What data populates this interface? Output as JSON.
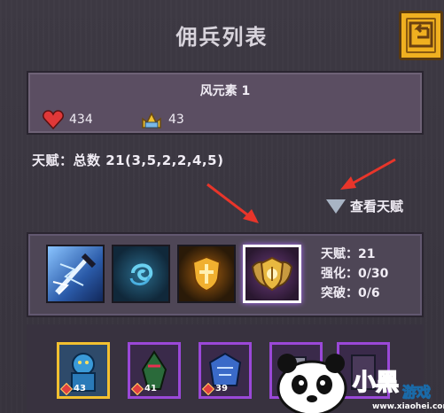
{
  "header": {
    "title": "佣兵列表"
  },
  "unit": {
    "name": "风元素 1",
    "hp": "434",
    "attack": "43"
  },
  "talents": {
    "total_line": "天赋：总数 21(3,5,2,2,4,5)",
    "view_label": "查看天赋"
  },
  "selected_skill": {
    "talent_line": "天赋：21",
    "enhance_line": "强化：0/30",
    "breakthrough_line": "突破：0/6"
  },
  "skills": [
    {
      "icon": "lightning-sword-icon",
      "color": "#3a6ab8"
    },
    {
      "icon": "wind-swirl-icon",
      "color": "#1e4a6a"
    },
    {
      "icon": "golden-shield-icon",
      "color": "#7a4a10"
    },
    {
      "icon": "winged-shield-emblem-icon",
      "color": "#5a2a6a",
      "selected": true
    }
  ],
  "mercenaries": [
    {
      "level": "43",
      "frame": "gold",
      "icon": "blue-knight-icon"
    },
    {
      "level": "41",
      "frame": "purple",
      "icon": "green-hooded-assassin-icon"
    },
    {
      "level": "39",
      "frame": "purple",
      "icon": "blue-dragon-rider-icon"
    },
    {
      "level": "",
      "frame": "purple",
      "icon": "armored-warrior-icon"
    },
    {
      "level": "",
      "frame": "purple",
      "icon": "dark-knight-icon"
    }
  ],
  "watermark": {
    "brand": "小黑游戏",
    "url": "www.xiaohei.com"
  }
}
